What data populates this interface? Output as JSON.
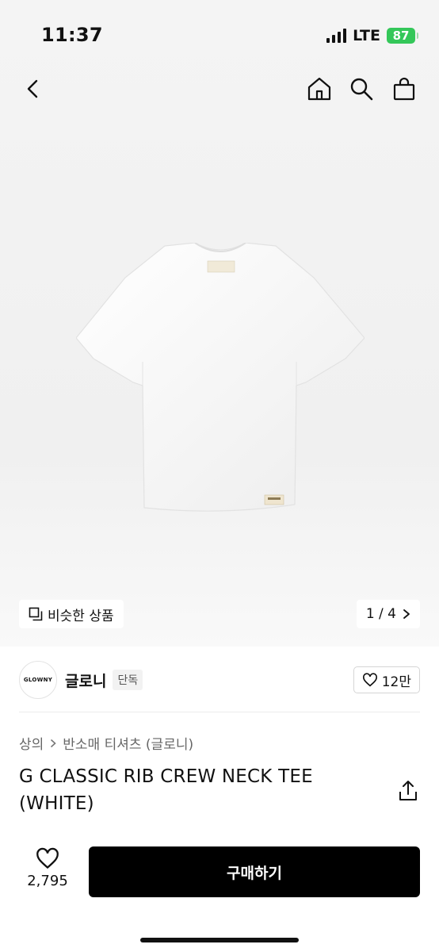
{
  "status": {
    "time": "11:37",
    "network": "LTE",
    "battery": "87"
  },
  "nav": {
    "back_icon": "chevron-left-icon",
    "home_icon": "home-icon",
    "search_icon": "search-icon",
    "bag_icon": "shopping-bag-icon"
  },
  "gallery": {
    "similar_label": "비슷한 상품",
    "pager": "1 / 4",
    "tee_label": "GLOWNY"
  },
  "brand": {
    "logo_text": "GLOWNY",
    "name": "글로니",
    "badge": "단독",
    "likes": "12만"
  },
  "breadcrumb": {
    "level1": "상의",
    "level2": "반소매 티셔츠 (글로니)"
  },
  "product": {
    "title": "G CLASSIC RIB CREW NECK TEE (WHITE)"
  },
  "bottom": {
    "wish_count": "2,795",
    "buy_label": "구매하기"
  },
  "colors": {
    "buy_button": "#000000",
    "battery": "#34c759"
  }
}
